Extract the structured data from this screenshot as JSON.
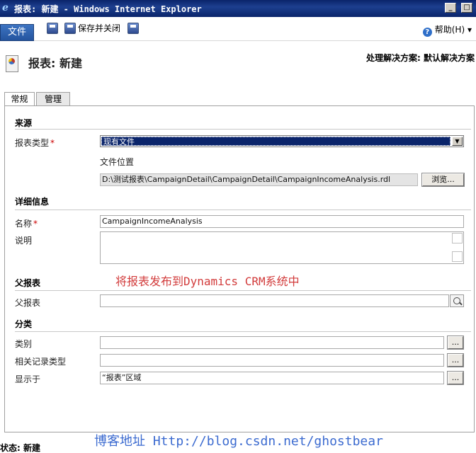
{
  "window": {
    "title": "报表: 新建 - Windows Internet Explorer"
  },
  "toolbar": {
    "file_label": "文件",
    "save_close_label": "保存并关闭",
    "help_label": "帮助(H)",
    "help_chevron": "▾"
  },
  "header": {
    "title": "报表: 新建",
    "solution": "处理解决方案: 默认解决方案"
  },
  "tabs": [
    {
      "label": "常规",
      "active": true
    },
    {
      "label": "管理",
      "active": false
    }
  ],
  "sections": {
    "source": {
      "title": "来源",
      "report_type_label": "报表类型",
      "report_type_value": "现有文件",
      "file_location_label": "文件位置",
      "file_path": "D:\\测试报表\\CampaignDetail\\CampaignDetail\\CampaignIncomeAnalysis.rdl",
      "browse_label": "浏览..."
    },
    "details": {
      "title": "详细信息",
      "name_label": "名称",
      "name_value": "CampaignIncomeAnalysis",
      "description_label": "说明"
    },
    "parent": {
      "title": "父报表",
      "parent_label": "父报表",
      "parent_value": ""
    },
    "category": {
      "title": "分类",
      "category_label": "类别",
      "related_label": "相关记录类型",
      "display_label": "显示于",
      "display_value": "“报表”区域",
      "ellipsis": "..."
    }
  },
  "required_marker": "*",
  "overlay_caption": "将报表发布到Dynamics CRM系统中",
  "watermark": "博客地址 Http://blog.csdn.net/ghostbear",
  "status": "状态: 新建",
  "colors": {
    "title_bar": "#0a246a",
    "accent": "#2f6fc9",
    "required": "#cc0000",
    "caption": "#d23b3b",
    "watermark": "#3c6bd0"
  }
}
